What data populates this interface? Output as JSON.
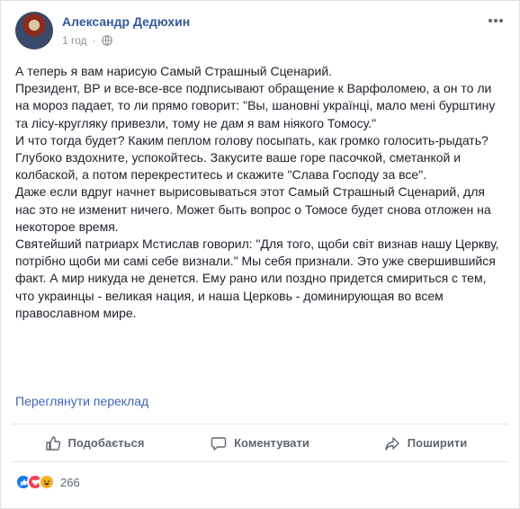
{
  "post": {
    "author": "Александр Дедюхин",
    "time": "1 год",
    "separator": "·",
    "paragraphs": [
      "А теперь я вам нарисую Самый Страшный Сценарий.",
      "Президент, ВР и все-все-все подписывают обращение к Варфоломею, а он то ли на мороз падает, то ли прямо говорит: \"Вы, шановні українці, мало мені бурштину та лісу-кругляку привезли, тому не дам я вам ніякого Томосу.\"",
      "И что тогда будет? Каким пеплом голову посыпать, как громко голосить-рыдать?",
      "Глубоко вздохните, успокойтесь. Закусите ваше горе пасочкой, сметанкой и колбаской, а потом перекреститесь и скажите \"Слава Господу за все\".",
      "Даже если вдруг начнет вырисовываться этот Самый Страшный Сценарий, для нас это не изменит ничего. Может быть вопрос о Томосе будет снова отложен на некоторое время.",
      "Святейший патриарх Мстислав говорил: \"Для того, щоби світ визнав нашу Церкву, потрібно щоби ми самі себе визнали.\" Мы себя признали. Это уже свершившийся факт. А мир никуда не денется. Ему рано или поздно придется смириться с тем, что украинцы - великая нация, и наша Церковь - доминирующая во всем православном мире."
    ],
    "translate_link": "Переглянути переклад"
  },
  "actions": {
    "like": "Подобається",
    "comment": "Коментувати",
    "share": "Поширити"
  },
  "reactions": {
    "icons": [
      "like-icon",
      "love-icon",
      "haha-icon"
    ],
    "count": "266"
  },
  "colors": {
    "link": "#365899",
    "like": "#1877f2",
    "love": "#f33e58",
    "haha": "#f7b125",
    "muted": "#606770"
  }
}
